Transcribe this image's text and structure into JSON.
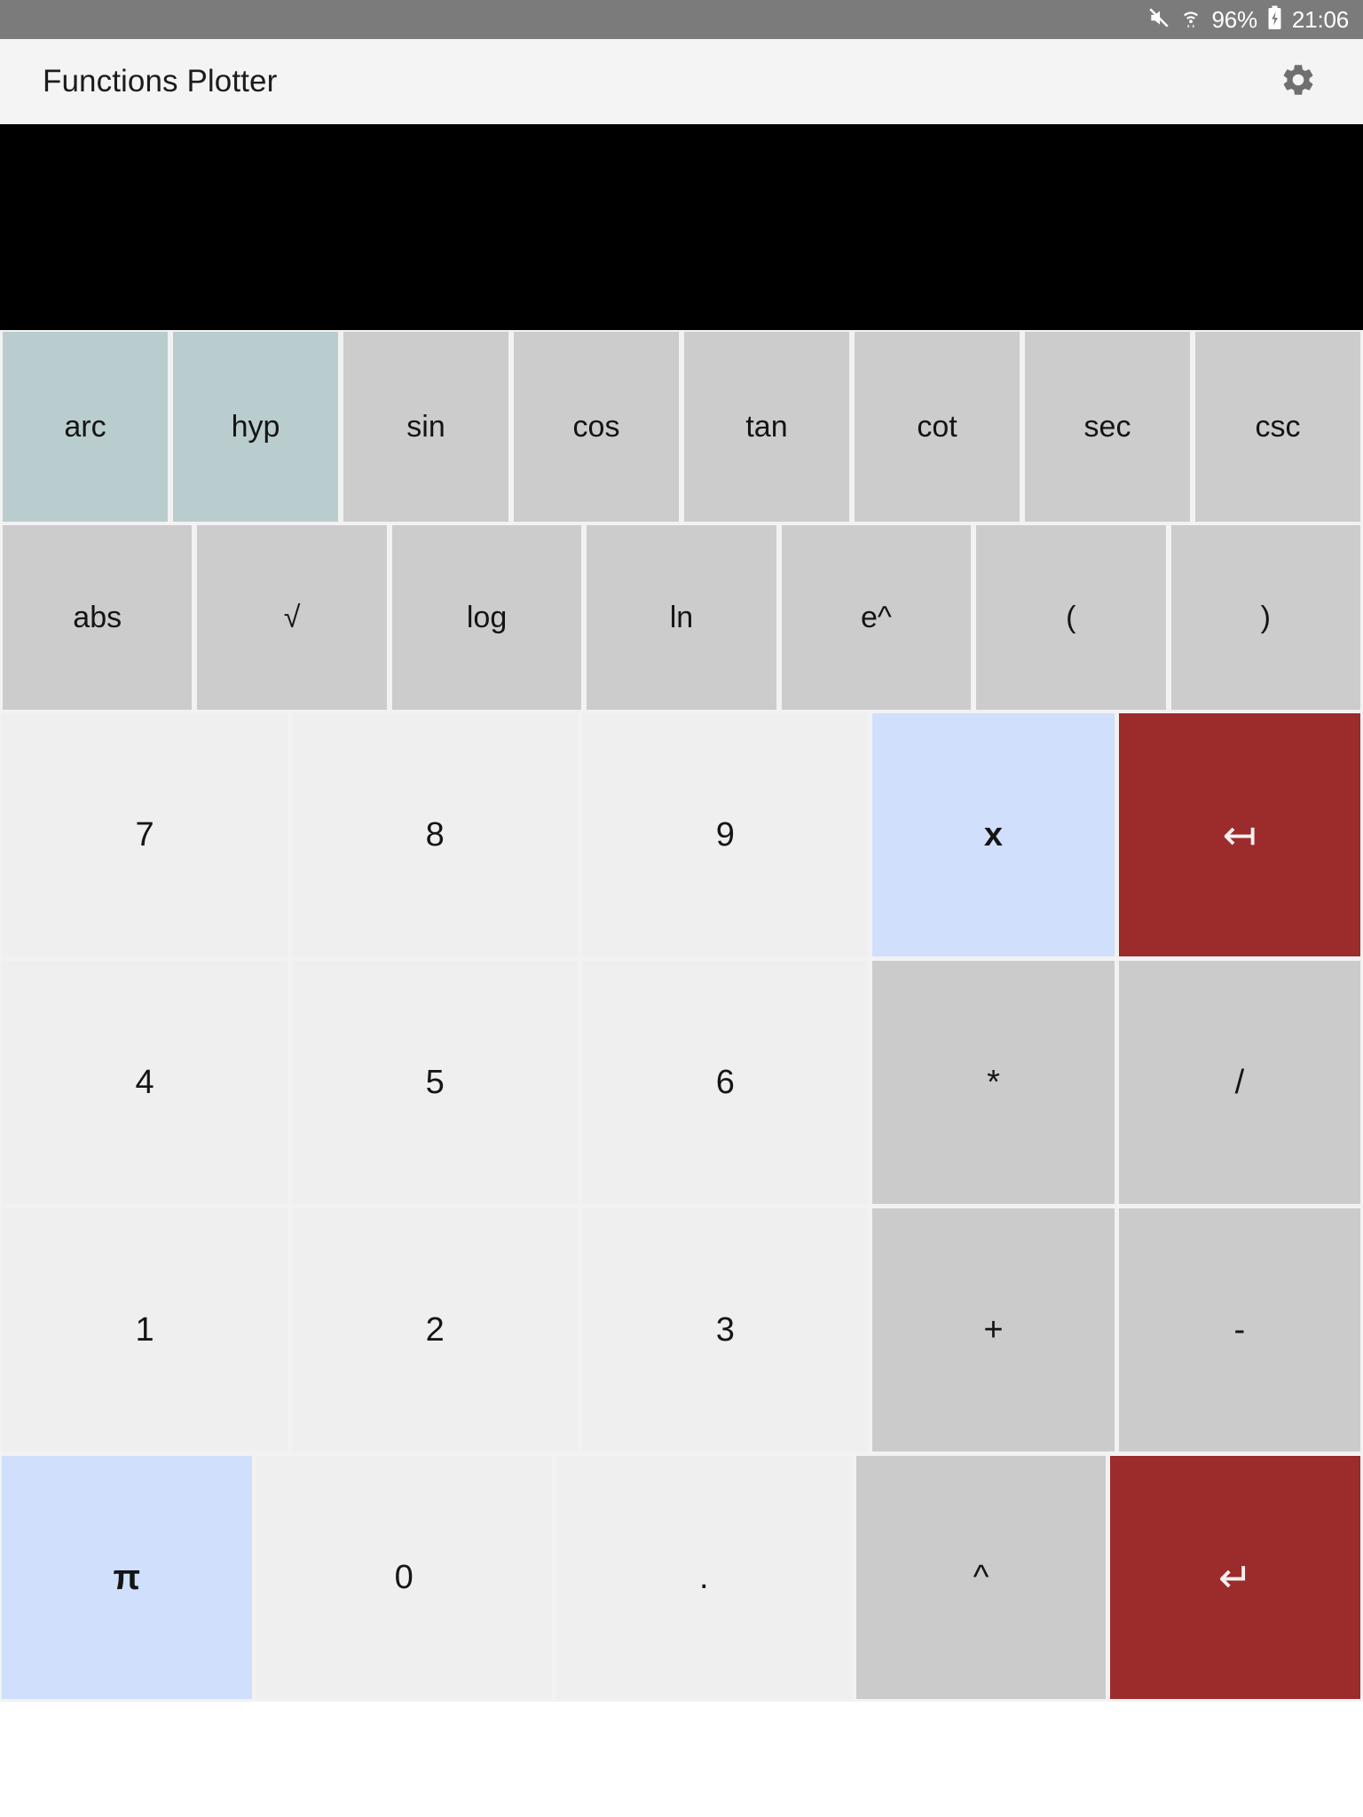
{
  "statusbar": {
    "battery_percent": "96%",
    "time": "21:06",
    "icons": [
      "mute-icon",
      "wifi-icon",
      "battery-charging-icon"
    ]
  },
  "appbar": {
    "title": "Functions Plotter",
    "settings_icon": "gear-icon"
  },
  "plot": {
    "background_color": "#000000"
  },
  "function_rows": [
    {
      "row": 1,
      "buttons": [
        {
          "label": "arc",
          "style": "mod"
        },
        {
          "label": "hyp",
          "style": "mod"
        },
        {
          "label": "sin",
          "style": "fn"
        },
        {
          "label": "cos",
          "style": "fn"
        },
        {
          "label": "tan",
          "style": "fn"
        },
        {
          "label": "cot",
          "style": "fn"
        },
        {
          "label": "sec",
          "style": "fn"
        },
        {
          "label": "csc",
          "style": "fn"
        }
      ]
    },
    {
      "row": 2,
      "buttons": [
        {
          "label": "abs",
          "style": "fn"
        },
        {
          "label": "√",
          "style": "fn"
        },
        {
          "label": "log",
          "style": "fn"
        },
        {
          "label": "ln",
          "style": "fn"
        },
        {
          "label": "e^",
          "style": "fn"
        },
        {
          "label": "(",
          "style": "fn"
        },
        {
          "label": ")",
          "style": "fn"
        }
      ]
    }
  ],
  "keypad": {
    "rows": [
      [
        {
          "label": "7",
          "kind": "num",
          "name": "key-7"
        },
        {
          "label": "8",
          "kind": "num",
          "name": "key-8"
        },
        {
          "label": "9",
          "kind": "num",
          "name": "key-9"
        },
        {
          "label": "x",
          "kind": "var",
          "name": "key-variable-x"
        },
        {
          "label": "↤",
          "kind": "act",
          "name": "key-backspace"
        }
      ],
      [
        {
          "label": "4",
          "kind": "num",
          "name": "key-4"
        },
        {
          "label": "5",
          "kind": "num",
          "name": "key-5"
        },
        {
          "label": "6",
          "kind": "num",
          "name": "key-6"
        },
        {
          "label": "*",
          "kind": "op",
          "name": "key-multiply"
        },
        {
          "label": "/",
          "kind": "op",
          "name": "key-divide"
        }
      ],
      [
        {
          "label": "1",
          "kind": "num",
          "name": "key-1"
        },
        {
          "label": "2",
          "kind": "num",
          "name": "key-2"
        },
        {
          "label": "3",
          "kind": "num",
          "name": "key-3"
        },
        {
          "label": "+",
          "kind": "op",
          "name": "key-plus"
        },
        {
          "label": "-",
          "kind": "op",
          "name": "key-minus"
        }
      ],
      [
        {
          "label": "π",
          "kind": "var",
          "name": "key-pi"
        },
        {
          "label": "0",
          "kind": "num",
          "name": "key-0"
        },
        {
          "label": ".",
          "kind": "num",
          "name": "key-decimal-point"
        },
        {
          "label": "^",
          "kind": "op",
          "name": "key-power"
        },
        {
          "label": "↵",
          "kind": "act",
          "name": "key-enter"
        }
      ]
    ]
  },
  "colors": {
    "statusbar_bg": "#7b7b7b",
    "appbar_bg": "#f4f4f4",
    "plot_bg": "#000000",
    "fn_key": "#cccccc",
    "mod_key": "#bacdce",
    "num_key": "#efefef",
    "op_key": "#cbcbcb",
    "var_key": "#cfdffc",
    "action_key": "#9c2b2b"
  }
}
